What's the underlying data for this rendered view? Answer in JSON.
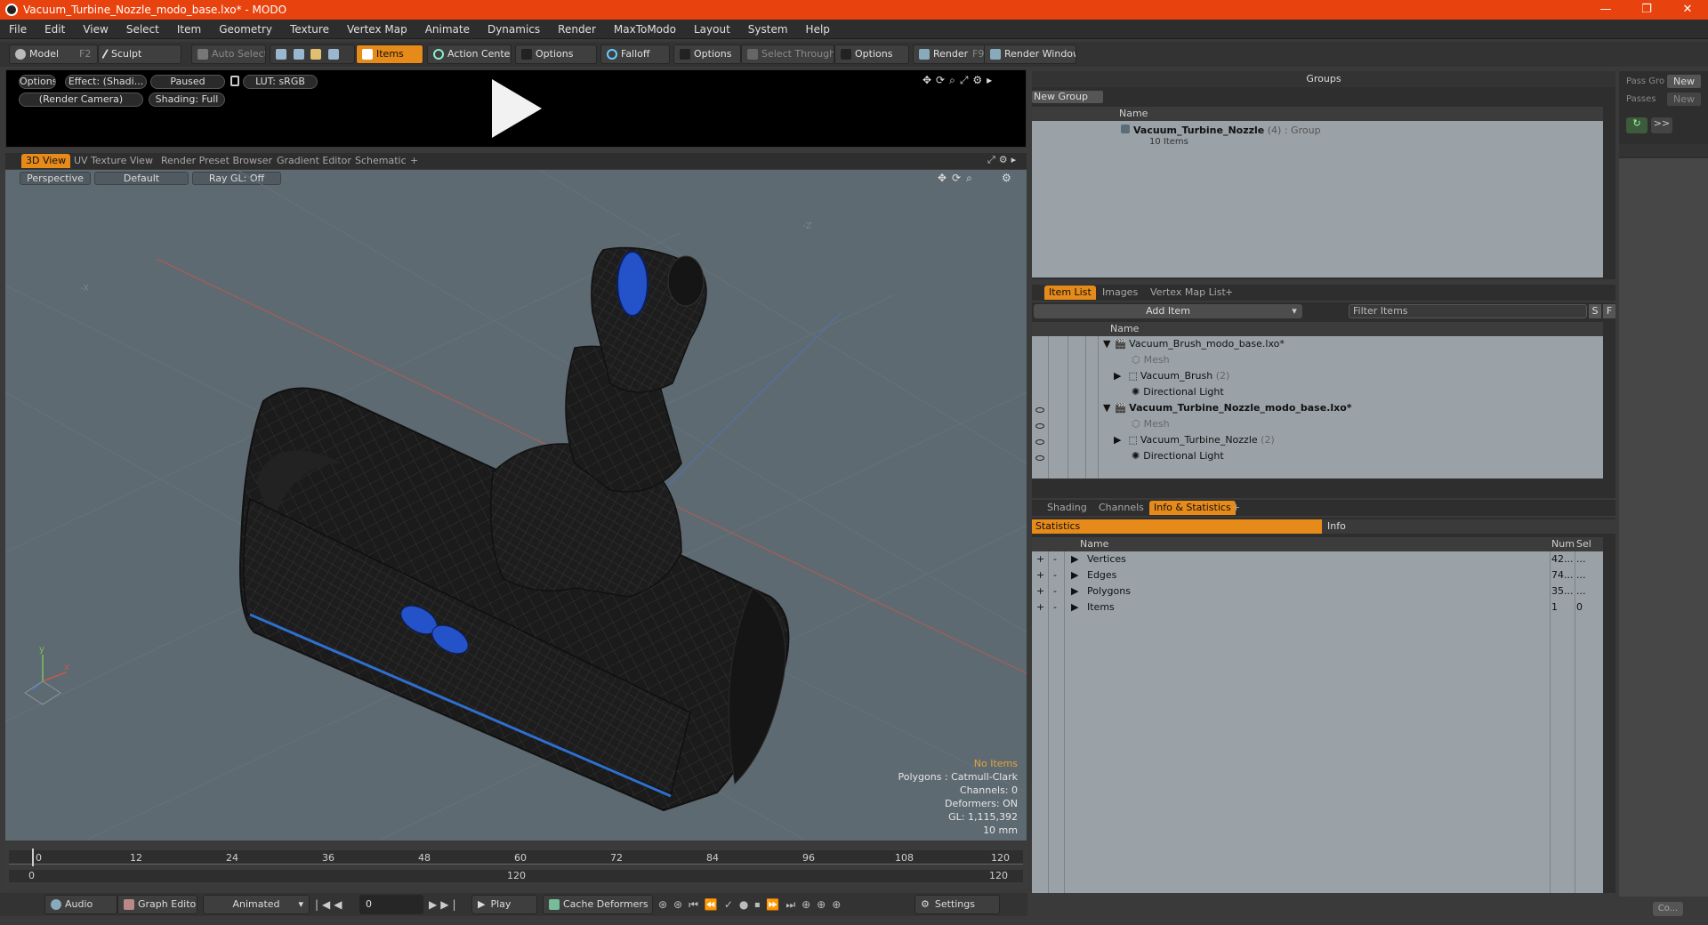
{
  "window": {
    "title": "Vacuum_Turbine_Nozzle_modo_base.lxo* - MODO",
    "controls": [
      "—",
      "❐",
      "✕"
    ]
  },
  "menu": [
    "File",
    "Edit",
    "View",
    "Select",
    "Item",
    "Geometry",
    "Texture",
    "Vertex Map",
    "Animate",
    "Dynamics",
    "Render",
    "MaxToModo",
    "Layout",
    "System",
    "Help"
  ],
  "toolbar": {
    "model": "Model",
    "model_key": "F2",
    "sculpt": "Sculpt",
    "auto_select": "Auto Select",
    "items": "Items",
    "action_center": "Action Center",
    "options1": "Options",
    "falloff": "Falloff",
    "options2": "Options",
    "select_through": "Select Through",
    "options3": "Options",
    "render": "Render",
    "render_key": "F9",
    "render_window": "Render Window"
  },
  "preview": {
    "options": "Options",
    "effect": "Effect: (Shadi...",
    "paused": "Paused",
    "lut": "LUT: sRGB",
    "camera": "(Render Camera)",
    "shading": "Shading: Full"
  },
  "viewport_tabs": [
    "3D View",
    "UV Texture View",
    "Render Preset Browser",
    "Gradient Editor",
    "Schematic",
    "+"
  ],
  "viewport": {
    "perspective": "Perspective",
    "default": "Default",
    "raygl": "Ray GL: Off",
    "axis_neg_x": "-X",
    "axis_neg_z": "-Z",
    "info": {
      "no_items": "No Items",
      "polygons": "Polygons : Catmull-Clark",
      "channels": "Channels: 0",
      "deformers": "Deformers: ON",
      "gl": "GL: 1,115,392",
      "scale": "10 mm"
    }
  },
  "timeline": {
    "ticks": [
      "0",
      "12",
      "24",
      "36",
      "48",
      "60",
      "72",
      "84",
      "96",
      "108",
      "120"
    ],
    "range_start": "0",
    "range_mid": "120",
    "range_end": "120"
  },
  "bottombar": {
    "audio": "Audio",
    "graph_editor": "Graph Editor",
    "animated": "Animated",
    "frame": "0",
    "play": "Play",
    "cache_deformers": "Cache Deformers",
    "settings": "Settings"
  },
  "groups": {
    "title": "Groups",
    "new_group": "New Group",
    "col_name": "Name",
    "group_name": "Vacuum_Turbine_Nozzle",
    "group_count": "(4)",
    "group_type": ": Group",
    "group_items": "10 Items"
  },
  "passes": {
    "pass_groups": "Pass Gro",
    "passes": "Passes",
    "new1": "New",
    "new2": "New",
    "forward": ">>",
    "co": "Co..."
  },
  "itemlist": {
    "tabs": [
      "Item List",
      "Images",
      "Vertex Map List",
      "+"
    ],
    "add_item": "Add Item",
    "filter": "Filter Items",
    "s": "S",
    "f": "F",
    "col_name": "Name",
    "rows": [
      {
        "label": "Vacuum_Brush_modo_base.lxo*",
        "count": "",
        "bold": false,
        "dim": false
      },
      {
        "label": "Mesh",
        "count": "",
        "bold": false,
        "dim": true
      },
      {
        "label": "Vacuum_Brush",
        "count": "(2)",
        "bold": false,
        "dim": false
      },
      {
        "label": "Directional Light",
        "count": "",
        "bold": false,
        "dim": false
      },
      {
        "label": "Vacuum_Turbine_Nozzle_modo_base.lxo*",
        "count": "",
        "bold": true,
        "dim": false
      },
      {
        "label": "Mesh",
        "count": "",
        "bold": false,
        "dim": true
      },
      {
        "label": "Vacuum_Turbine_Nozzle",
        "count": "(2)",
        "bold": false,
        "dim": false
      },
      {
        "label": "Directional Light",
        "count": "",
        "bold": false,
        "dim": false
      }
    ]
  },
  "stats": {
    "tabs": [
      "Shading",
      "Channels",
      "Info & Statistics",
      "+"
    ],
    "statistics": "Statistics",
    "info": "Info",
    "col_name": "Name",
    "col_num": "Num",
    "col_sel": "Sel",
    "rows": [
      {
        "name": "Vertices",
        "num": "42...",
        "sel": "..."
      },
      {
        "name": "Edges",
        "num": "74...",
        "sel": "..."
      },
      {
        "name": "Polygons",
        "num": "35...",
        "sel": "..."
      },
      {
        "name": "Items",
        "num": "1",
        "sel": "0"
      }
    ]
  },
  "colors": {
    "accent": "#e68a1a",
    "titlebar": "#e8430e",
    "viewport_bg": "#5e6a72"
  }
}
